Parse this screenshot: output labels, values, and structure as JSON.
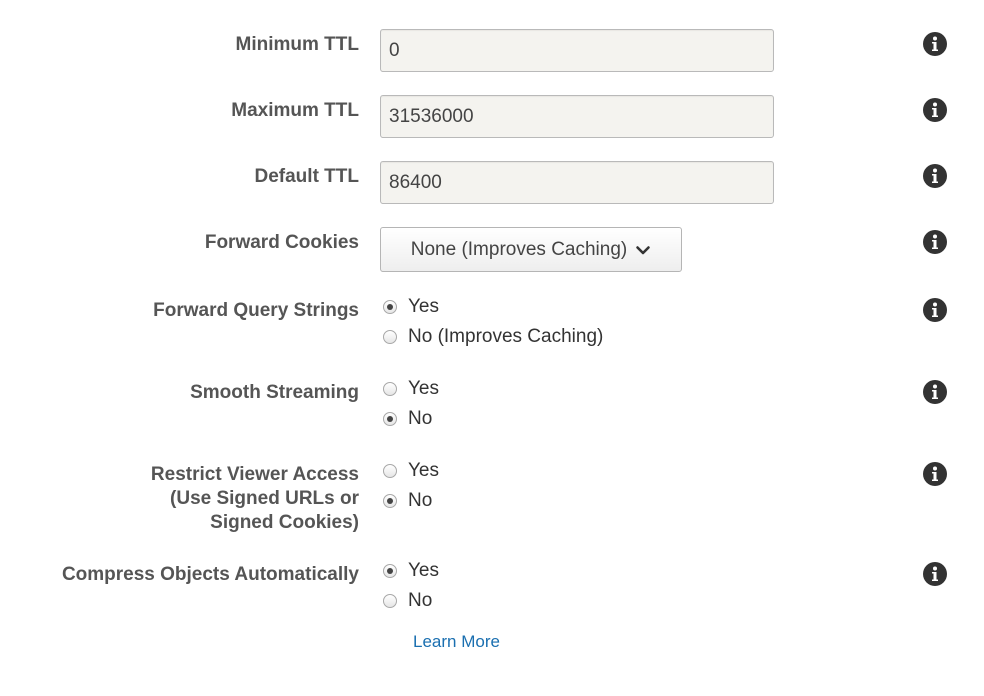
{
  "settings": {
    "minimum_ttl": {
      "label": "Minimum TTL",
      "value": "0"
    },
    "maximum_ttl": {
      "label": "Maximum TTL",
      "value": "31536000"
    },
    "default_ttl": {
      "label": "Default TTL",
      "value": "86400"
    },
    "forward_cookies": {
      "label": "Forward Cookies",
      "selected": "None (Improves Caching)"
    },
    "forward_query_strings": {
      "label": "Forward Query Strings",
      "options": [
        "Yes",
        "No (Improves Caching)"
      ],
      "selected": "Yes"
    },
    "smooth_streaming": {
      "label": "Smooth Streaming",
      "options": [
        "Yes",
        "No"
      ],
      "selected": "No"
    },
    "restrict_viewer_access": {
      "label_lines": [
        "Restrict Viewer Access",
        "(Use Signed URLs or",
        "Signed Cookies)"
      ],
      "options": [
        "Yes",
        "No"
      ],
      "selected": "No"
    },
    "compress_objects": {
      "label": "Compress Objects Automatically",
      "options": [
        "Yes",
        "No"
      ],
      "selected": "Yes"
    }
  },
  "learn_more": "Learn More",
  "icons": {
    "info": "info-circle-icon",
    "chevron": "chevron-down-icon"
  },
  "colors": {
    "label": "#555555",
    "input_bg": "#f4f3ef",
    "link": "#1a6fb0",
    "info_icon": "#333333"
  }
}
